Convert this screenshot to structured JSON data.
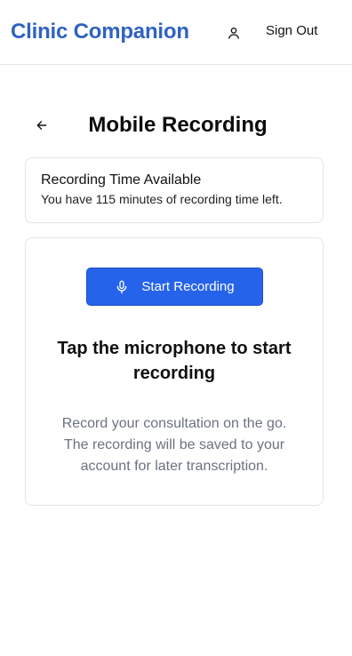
{
  "header": {
    "brand": "Clinic Companion",
    "user_icon": "user-icon",
    "sign_out_label": "Sign Out"
  },
  "page": {
    "back_icon": "arrow-left-icon",
    "title": "Mobile Recording"
  },
  "recording_time": {
    "title": "Recording Time Available",
    "description": "You have 115 minutes of recording time left.",
    "minutes_left": 115
  },
  "recorder": {
    "mic_icon": "microphone-icon",
    "start_label": "Start Recording",
    "prompt": "Tap the microphone to start recording",
    "helper_text": "Record your consultation on the go. The recording will be saved to your account for later transcription."
  },
  "colors": {
    "brand": "#2f63bf",
    "primary_button": "#2563eb",
    "border": "#e3e5e8",
    "muted_text": "#6b7280"
  }
}
